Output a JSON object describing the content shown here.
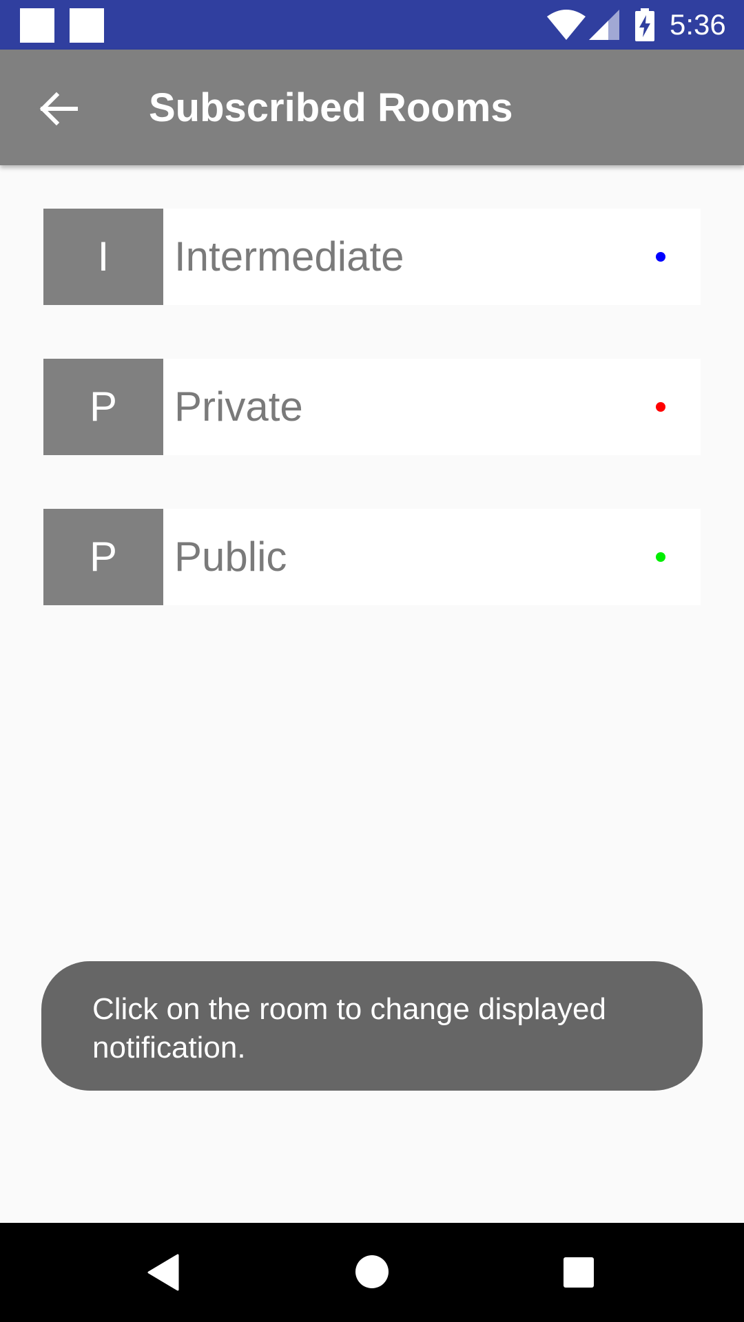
{
  "status_bar": {
    "time": "5:36",
    "icons": [
      "notification-square-icon",
      "notification-square-icon",
      "wifi-icon",
      "signal-icon",
      "battery-charging-icon"
    ]
  },
  "app_bar": {
    "title": "Subscribed Rooms",
    "back_icon": "arrow-left-icon"
  },
  "rooms": [
    {
      "initial": "I",
      "name": "Intermediate",
      "dot_color": "#0000ff"
    },
    {
      "initial": "P",
      "name": "Private",
      "dot_color": "#ff0000"
    },
    {
      "initial": "P",
      "name": "Public",
      "dot_color": "#00ee00"
    }
  ],
  "toast": {
    "message": "Click on the room to change displayed notification."
  },
  "nav_bar": {
    "icons": [
      "nav-back-icon",
      "nav-home-icon",
      "nav-recents-icon"
    ]
  },
  "colors": {
    "status_bar": "#303f9f",
    "app_bar": "#808080",
    "background": "#fafafa",
    "toast": "#666666"
  }
}
